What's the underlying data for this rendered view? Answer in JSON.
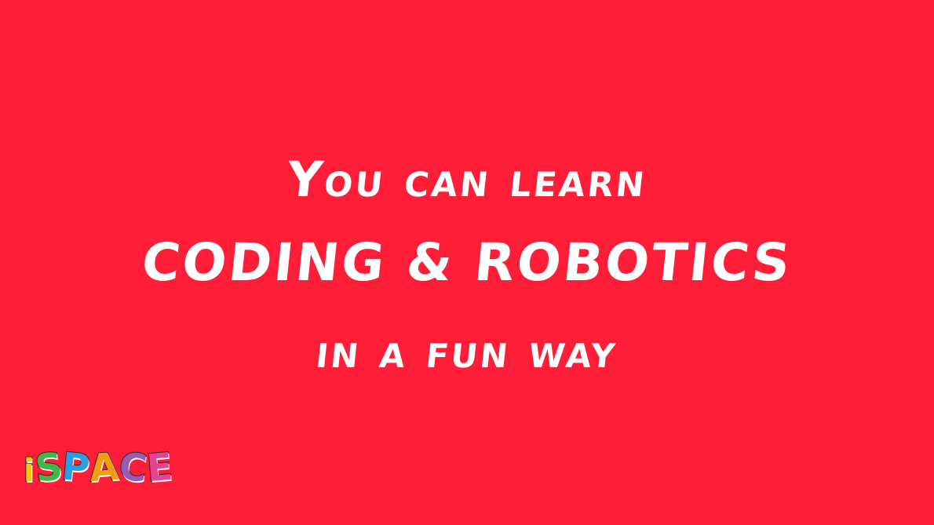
{
  "headline": {
    "line1": "You can learn",
    "line2": "CODING & ROBOTICS",
    "line3": "in a fun way"
  },
  "logo": {
    "text": "iSPACE",
    "letters": [
      "i",
      "S",
      "P",
      "A",
      "C",
      "E"
    ]
  },
  "colors": {
    "background": "#ff1e37",
    "text": "#ffffff",
    "logo_i": "#f7c600",
    "logo_s": "#43b649",
    "logo_p": "#2f9be0",
    "logo_a": "#f39c12",
    "logo_c": "#9b59b6",
    "logo_e": "#e84393"
  }
}
